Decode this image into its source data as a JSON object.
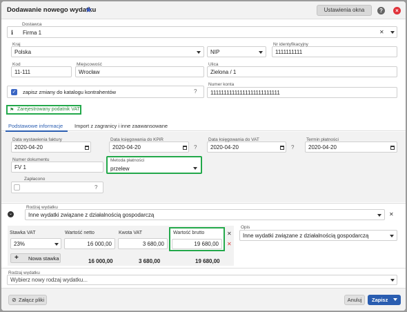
{
  "window": {
    "title": "Dodawanie nowego wydatku",
    "settings_label": "Ustawienia okna",
    "help_glyph": "?",
    "close_glyph": "×"
  },
  "supplier": {
    "label": "Dostawca",
    "value": "Firma 1",
    "info_glyph": "i"
  },
  "country": {
    "label": "Kraj",
    "value": "Polska"
  },
  "id_type": {
    "value": "NIP"
  },
  "tax_id": {
    "label": "Nr identyfikacyjny",
    "value": "1111111111"
  },
  "postal_code": {
    "label": "Kod",
    "value": "11-111"
  },
  "city": {
    "label": "Miejscowość",
    "value": "Wrocław"
  },
  "street": {
    "label": "Ulica",
    "value": "Zielona / 1"
  },
  "save_changes": {
    "label": "zapisz zmiany do katalogu kontrahentów",
    "checked": true,
    "help": "?"
  },
  "account": {
    "label": "Numer konta",
    "value": "11111111111111111111111111"
  },
  "vat_badge": {
    "label": "Zarejestrowany podatnik VAT"
  },
  "tabs": [
    {
      "label": "Podstawowe informacje",
      "active": true
    },
    {
      "label": "Import z zagranicy i inne zaawansowane",
      "active": false
    }
  ],
  "issue_date": {
    "label": "Data wystawienia faktury",
    "value": "2020-04-20"
  },
  "kpir_date": {
    "label": "Data księgowania do KPiR",
    "value": "2020-04-20"
  },
  "vat_date": {
    "label": "Data księgowania do VAT",
    "value": "2020-04-20"
  },
  "due_date": {
    "label": "Termin płatności",
    "value": "2020-04-20"
  },
  "doc_number": {
    "label": "Numer dokumentu",
    "value": "FV 1"
  },
  "payment_method": {
    "label": "Metoda płatności",
    "value": "przelew"
  },
  "paid": {
    "label": "Zapłacono",
    "help": "?"
  },
  "expense_type": {
    "label": "Rodzaj wydatku",
    "value": "Inne wydatki związane z działalnością gospodarczą"
  },
  "vat_table": {
    "headers": [
      "Stawka VAT",
      "Wartość netto",
      "Kwota VAT",
      "Wartość brutto"
    ],
    "rows": [
      {
        "rate": "23%",
        "net": "16 000,00",
        "vat": "3 680,00",
        "gross": "19 680,00"
      }
    ],
    "add_label": "Nowa stawka",
    "totals": {
      "net": "16 000,00",
      "vat": "3 680,00",
      "gross": "19 680,00"
    }
  },
  "description": {
    "label": "Opis",
    "value": "Inne wydatki związane z działalnością gospodarczą"
  },
  "new_expense_type": {
    "label": "Rodzaj wydatku",
    "placeholder": "Wybierz nowy rodzaj wydatku..."
  },
  "footer": {
    "attach_label": "Załącz pliki",
    "cancel_label": "Anuluj",
    "save_label": "Zapisz"
  },
  "colors": {
    "accent": "#2a5db0",
    "green": "#22a84a",
    "danger": "#e0323a"
  }
}
